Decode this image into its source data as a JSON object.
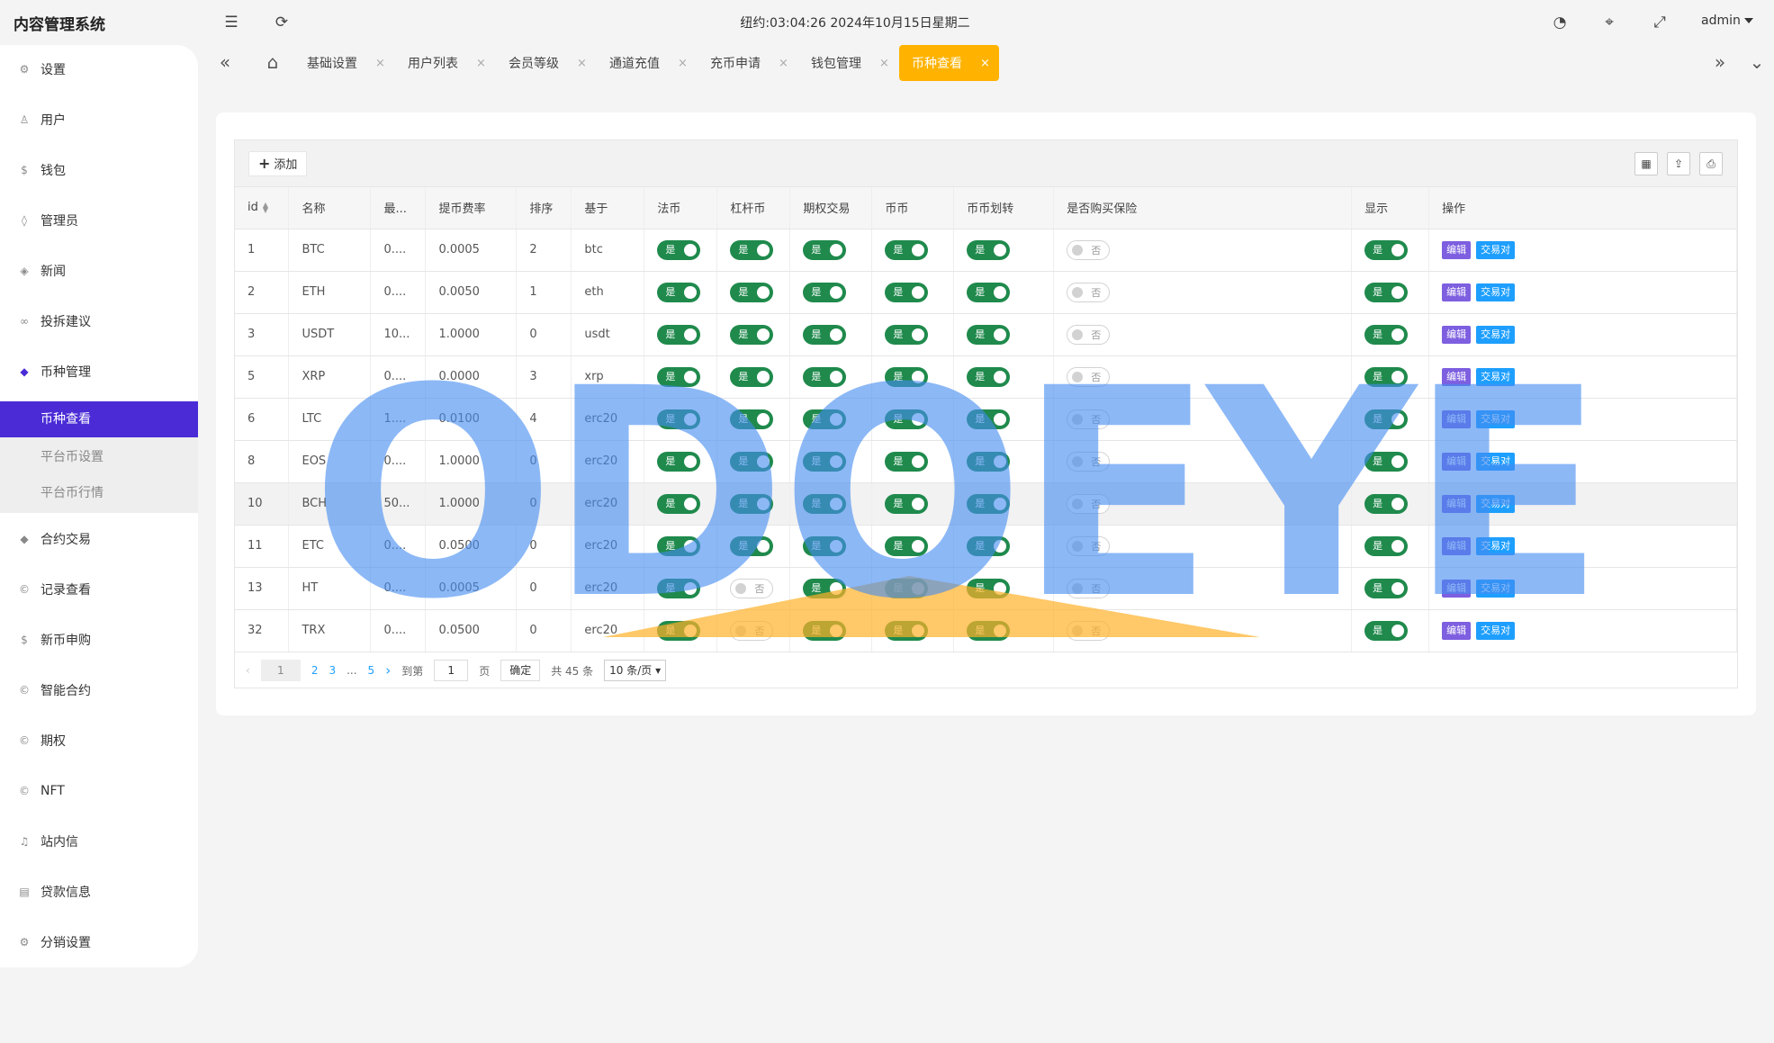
{
  "app_title": "内容管理系统",
  "header": {
    "clock": "纽约:03:04:26 2024年10月15日星期二",
    "user": "admin"
  },
  "sidebar": {
    "items": [
      {
        "label": "设置",
        "icon": "gear-icon"
      },
      {
        "label": "用户",
        "icon": "user-icon"
      },
      {
        "label": "钱包",
        "icon": "dollar-icon"
      },
      {
        "label": "管理员",
        "icon": "shield-icon"
      },
      {
        "label": "新闻",
        "icon": "tag-icon"
      },
      {
        "label": "投拆建议",
        "icon": "link-icon"
      },
      {
        "label": "币种管理",
        "icon": "diamond-icon"
      },
      {
        "label": "合约交易",
        "icon": "diamond-icon"
      },
      {
        "label": "记录查看",
        "icon": "circle-c-icon"
      },
      {
        "label": "新币申购",
        "icon": "dollar-icon"
      },
      {
        "label": "智能合约",
        "icon": "circle-c-icon"
      },
      {
        "label": "期权",
        "icon": "circle-c-icon"
      },
      {
        "label": "NFT",
        "icon": "circle-c-icon"
      },
      {
        "label": "站内信",
        "icon": "bell-icon"
      },
      {
        "label": "贷款信息",
        "icon": "doc-icon"
      },
      {
        "label": "分销设置",
        "icon": "gear-icon"
      }
    ],
    "sub_items": [
      "币种查看",
      "平台币设置",
      "平台币行情"
    ]
  },
  "tabs": [
    "基础设置",
    "用户列表",
    "会员等级",
    "通道充值",
    "充币申请",
    "钱包管理",
    "币种查看"
  ],
  "toolbar": {
    "add_label": "添加"
  },
  "table": {
    "headers": [
      "id",
      "名称",
      "最...",
      "提币费率",
      "排序",
      "基于",
      "法币",
      "杠杆币",
      "期权交易",
      "币币",
      "币币划转",
      "是否购买保险",
      "显示",
      "操作"
    ],
    "switch_on": "是",
    "switch_off": "否",
    "edit_label": "编辑",
    "pair_label": "交易对",
    "rows": [
      {
        "id": "1",
        "name": "BTC",
        "min": "0....",
        "fee": "0.0005",
        "sort": "2",
        "base": "btc",
        "fabi": true,
        "ganggan": true,
        "qiquan": true,
        "bibi": true,
        "huazhuan": true,
        "baoxian": false,
        "show": true
      },
      {
        "id": "2",
        "name": "ETH",
        "min": "0....",
        "fee": "0.0050",
        "sort": "1",
        "base": "eth",
        "fabi": true,
        "ganggan": true,
        "qiquan": true,
        "bibi": true,
        "huazhuan": true,
        "baoxian": false,
        "show": true
      },
      {
        "id": "3",
        "name": "USDT",
        "min": "10...",
        "fee": "1.0000",
        "sort": "0",
        "base": "usdt",
        "fabi": true,
        "ganggan": true,
        "qiquan": true,
        "bibi": true,
        "huazhuan": true,
        "baoxian": false,
        "show": true
      },
      {
        "id": "5",
        "name": "XRP",
        "min": "0....",
        "fee": "0.0000",
        "sort": "3",
        "base": "xrp",
        "fabi": true,
        "ganggan": true,
        "qiquan": true,
        "bibi": true,
        "huazhuan": true,
        "baoxian": false,
        "show": true
      },
      {
        "id": "6",
        "name": "LTC",
        "min": "1....",
        "fee": "0.0100",
        "sort": "4",
        "base": "erc20",
        "fabi": true,
        "ganggan": true,
        "qiquan": true,
        "bibi": true,
        "huazhuan": true,
        "baoxian": false,
        "show": true
      },
      {
        "id": "8",
        "name": "EOS",
        "min": "0....",
        "fee": "1.0000",
        "sort": "0",
        "base": "erc20",
        "fabi": true,
        "ganggan": true,
        "qiquan": true,
        "bibi": true,
        "huazhuan": true,
        "baoxian": false,
        "show": true
      },
      {
        "id": "10",
        "name": "BCH",
        "min": "50...",
        "fee": "1.0000",
        "sort": "0",
        "base": "erc20",
        "fabi": true,
        "ganggan": true,
        "qiquan": true,
        "bibi": true,
        "huazhuan": true,
        "baoxian": false,
        "show": true
      },
      {
        "id": "11",
        "name": "ETC",
        "min": "0....",
        "fee": "0.0500",
        "sort": "0",
        "base": "erc20",
        "fabi": true,
        "ganggan": true,
        "qiquan": true,
        "bibi": true,
        "huazhuan": true,
        "baoxian": false,
        "show": true
      },
      {
        "id": "13",
        "name": "HT",
        "min": "0....",
        "fee": "0.0005",
        "sort": "0",
        "base": "erc20",
        "fabi": true,
        "ganggan": false,
        "qiquan": true,
        "bibi": true,
        "huazhuan": true,
        "baoxian": false,
        "show": true
      },
      {
        "id": "32",
        "name": "TRX",
        "min": "0....",
        "fee": "0.0500",
        "sort": "0",
        "base": "erc20",
        "fabi": true,
        "ganggan": false,
        "qiquan": true,
        "bibi": true,
        "huazhuan": true,
        "baoxian": false,
        "show": true
      }
    ]
  },
  "pager": {
    "pages": [
      "1",
      "2",
      "3",
      "...",
      "5"
    ],
    "goto_label": "到第",
    "goto_value": "1",
    "page_unit": "页",
    "confirm_label": "确定",
    "total": "共 45 条",
    "per_page": "10 条/页"
  },
  "watermark": "ODOEYE",
  "colors": {
    "accent": "#4a2bd6",
    "active_tab": "#ffb300",
    "switch_on": "#1f8a4c",
    "edit": "#7d5fe0",
    "pair": "#1e9fff"
  }
}
